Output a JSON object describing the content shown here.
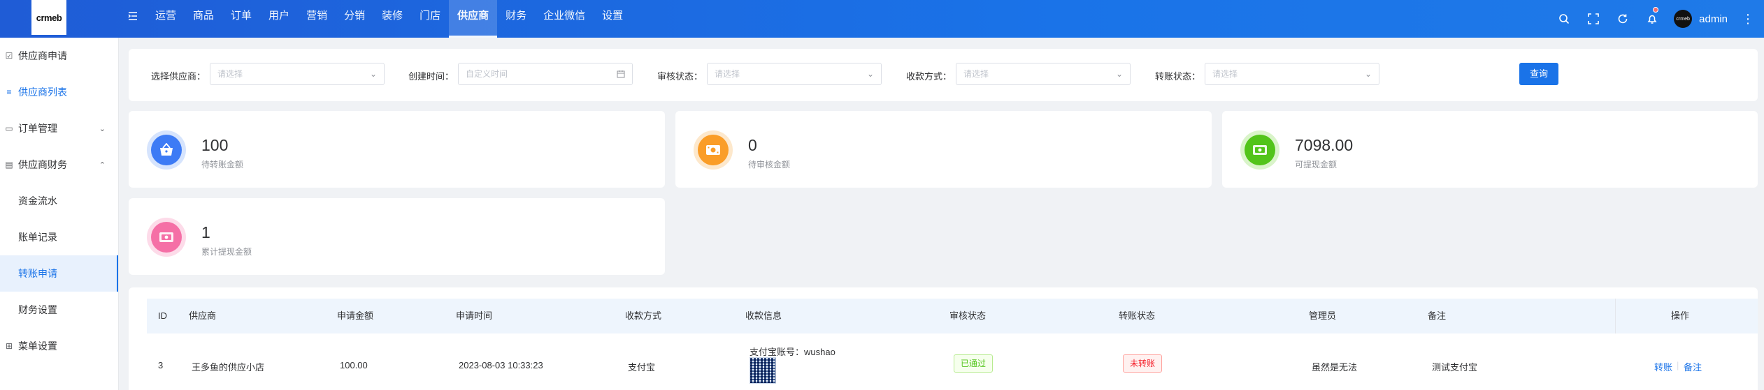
{
  "brand": {
    "logo_text": "crmeb"
  },
  "nav": {
    "items": [
      "运营",
      "商品",
      "订单",
      "用户",
      "营销",
      "分销",
      "装修",
      "门店",
      "供应商",
      "财务",
      "企业微信",
      "设置"
    ],
    "active": "供应商"
  },
  "user": {
    "name": "admin",
    "avatar_text": "crmeb"
  },
  "sidebar": {
    "items": [
      {
        "label": "供应商申请",
        "icon": "checkbox-icon"
      },
      {
        "label": "供应商列表",
        "icon": "list-icon"
      },
      {
        "label": "订单管理",
        "icon": "document-icon",
        "expand": "down"
      },
      {
        "label": "供应商财务",
        "icon": "finance-icon",
        "expand": "up"
      },
      {
        "label": "资金流水"
      },
      {
        "label": "账单记录"
      },
      {
        "label": "转账申请",
        "active": true
      },
      {
        "label": "财务设置"
      },
      {
        "label": "菜单设置",
        "icon": "grid-icon"
      }
    ]
  },
  "filters": {
    "supplier_label": "选择供应商：",
    "supplier_placeholder": "请选择",
    "created_label": "创建时间：",
    "created_placeholder": "自定义时间",
    "audit_label": "审核状态：",
    "audit_placeholder": "请选择",
    "payment_label": "收款方式：",
    "payment_placeholder": "请选择",
    "transfer_label": "转账状态：",
    "transfer_placeholder": "请选择",
    "query_button": "查询"
  },
  "stats": [
    {
      "value": "100",
      "label": "待转账金额",
      "color": "#3d7bf5",
      "ring": "#d6e4fd",
      "icon": "basket-icon"
    },
    {
      "value": "0",
      "label": "待审核金额",
      "color": "#fa9d28",
      "ring": "#fde8cc",
      "icon": "money-icon"
    },
    {
      "value": "7098.00",
      "label": "可提现金额",
      "color": "#52c41a",
      "ring": "#d9f4c9",
      "icon": "cash-icon"
    },
    {
      "value": "1",
      "label": "累计提现金额",
      "color": "#f56fa6",
      "ring": "#fddbe9",
      "icon": "cash-icon"
    }
  ],
  "table": {
    "headers": [
      "ID",
      "供应商",
      "申请金额",
      "申请时间",
      "收款方式",
      "收款信息",
      "审核状态",
      "转账状态",
      "管理员",
      "备注",
      "操作"
    ],
    "rows": [
      {
        "id": "3",
        "supplier": "王多鱼的供应小店",
        "amount": "100.00",
        "time": "2023-08-03 10:33:23",
        "method": "支付宝",
        "info": "支付宝账号：wushao",
        "audit": "已通过",
        "transfer": "未转账",
        "admin": "虽然是无法",
        "remark": "测试支付宝",
        "action_transfer": "转账",
        "action_remark": "备注"
      }
    ]
  }
}
